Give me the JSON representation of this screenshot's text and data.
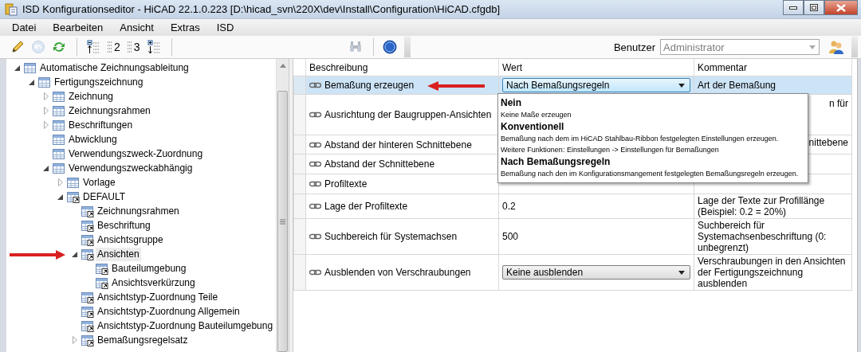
{
  "window": {
    "title": "ISD Konfigurationseditor  - HiCAD 22.1.0.223 [D:\\hicad_svn\\220X\\dev\\Install\\Configuration\\HiCAD.cfgdb]"
  },
  "menu": [
    "Datei",
    "Bearbeiten",
    "Ansicht",
    "Extras",
    "ISD"
  ],
  "toolbar": {
    "buttons": [
      {
        "kind": "edit",
        "disabled": false
      },
      {
        "kind": "undo",
        "disabled": true
      },
      {
        "kind": "refresh",
        "disabled": false
      },
      {
        "kind": "separator"
      },
      {
        "kind": "collapse",
        "disabled": false
      },
      {
        "kind": "level",
        "label": "2",
        "disabled": false
      },
      {
        "kind": "level",
        "label": "3",
        "disabled": false
      },
      {
        "kind": "expand",
        "disabled": false
      },
      {
        "kind": "separator"
      },
      {
        "kind": "spacer"
      },
      {
        "kind": "find",
        "disabled": true
      },
      {
        "kind": "separator"
      },
      {
        "kind": "help",
        "disabled": false
      }
    ],
    "user_label": "Benutzer",
    "user_value": "Administrator"
  },
  "tree": [
    {
      "label": "Automatische Zeichnungsableitung",
      "kind": "table",
      "expanded": true,
      "selected": false,
      "marked": false,
      "children": [
        {
          "label": "Fertigungszeichnung",
          "kind": "table",
          "expanded": true,
          "selected": false,
          "marked": false,
          "children": [
            {
              "label": "Zeichnung",
              "kind": "table",
              "expanded": false,
              "selected": false,
              "marked": false
            },
            {
              "label": "Zeichnungsrahmen",
              "kind": "table",
              "expanded": false,
              "selected": false,
              "marked": false
            },
            {
              "label": "Beschriftungen",
              "kind": "table",
              "expanded": false,
              "selected": false,
              "marked": false
            },
            {
              "label": "Abwicklung",
              "kind": "table",
              "selected": false,
              "marked": false
            },
            {
              "label": "Verwendungszweck-Zuordnung",
              "kind": "table",
              "selected": false,
              "marked": false
            },
            {
              "label": "Verwendungszweckabhängig",
              "kind": "table",
              "expanded": true,
              "selected": false,
              "marked": false,
              "children": [
                {
                  "label": "Vorlage",
                  "kind": "table",
                  "expanded": false,
                  "selected": false,
                  "marked": false
                },
                {
                  "label": "DEFAULT",
                  "kind": "link",
                  "expanded": true,
                  "selected": false,
                  "marked": false,
                  "children": [
                    {
                      "label": "Zeichnungsrahmen",
                      "kind": "link",
                      "selected": false,
                      "marked": false
                    },
                    {
                      "label": "Beschriftung",
                      "kind": "link",
                      "selected": false,
                      "marked": false
                    },
                    {
                      "label": "Ansichtsgruppe",
                      "kind": "link",
                      "selected": false,
                      "marked": false
                    },
                    {
                      "label": "Ansichten",
                      "kind": "link",
                      "expanded": true,
                      "selected": true,
                      "marked": true,
                      "children": [
                        {
                          "label": "Bauteilumgebung",
                          "kind": "link",
                          "selected": false,
                          "marked": false
                        },
                        {
                          "label": "Ansichtsverkürzung",
                          "kind": "link",
                          "selected": false,
                          "marked": false
                        }
                      ]
                    },
                    {
                      "label": "Ansichtstyp-Zuordnung Teile",
                      "kind": "link",
                      "selected": false,
                      "marked": false
                    },
                    {
                      "label": "Ansichtstyp-Zuordnung Allgemein",
                      "kind": "link",
                      "selected": false,
                      "marked": false
                    },
                    {
                      "label": "Ansichtstyp-Zuordnung Bauteilumgebung",
                      "kind": "link",
                      "selected": false,
                      "marked": false
                    },
                    {
                      "label": "Bemaßungsregelsatz",
                      "kind": "link",
                      "expanded": false,
                      "selected": false,
                      "marked": false
                    }
                  ]
                }
              ]
            }
          ]
        }
      ]
    }
  ],
  "grid": {
    "columns": [
      "Beschreibung",
      "Wert",
      "Kommentar"
    ],
    "rows": [
      {
        "description": "Bemaßung erzeugen",
        "kind": "dropdown",
        "value": "Nach Bemaßungsregeln",
        "comment": "Art der Bemaßung",
        "comment_covered": false,
        "selected": true,
        "marked": true,
        "open": true
      },
      {
        "description": "Ausrichtung der Baugruppen-Ansichten",
        "kind": "covered",
        "comment": "n für",
        "comment_covered": true,
        "selected": false,
        "marked": false
      },
      {
        "description": "Abstand der hinteren Schnittebene",
        "kind": "covered",
        "comment": "nittebene",
        "comment_covered": true,
        "selected": false,
        "marked": false
      },
      {
        "description": "Abstand der Schnittebene",
        "kind": "covered",
        "selected": false,
        "marked": false,
        "comment_covered": true
      },
      {
        "description": "Profiltexte",
        "kind": "covered",
        "selected": false,
        "marked": false,
        "comment_covered": true
      },
      {
        "description": "Lage der Profiltexte",
        "kind": "text",
        "value": "0.2",
        "comment": "Lage der Texte zur Profillänge (Beispiel: 0.2 = 20%)",
        "comment_covered": false,
        "selected": false,
        "marked": false
      },
      {
        "description": "Suchbereich für Systemachsen",
        "kind": "text",
        "value": "500",
        "comment": "Suchbereich für Systemachsenbeschriftung (0: unbegrenzt)",
        "comment_covered": false,
        "selected": false,
        "marked": false
      },
      {
        "description": "Ausblenden von Verschraubungen",
        "kind": "dropdown",
        "value": "Keine ausblenden",
        "comment": "Verschraubungen in den Ansichten der Fertigungszeichnung ausblenden",
        "comment_covered": false,
        "selected": false,
        "marked": false,
        "open": false
      }
    ],
    "dropdown_options": [
      {
        "title": "Nein",
        "lines": [
          "Keine Maße erzeugen"
        ]
      },
      {
        "title": "Konventionell",
        "lines": [
          "Bemaßung nach dem im HiCAD Stahlbau-Ribbon festgelegten Einstellungen erzeugen.",
          "Weitere Funktionen: Einstellungen -> Einstellungen für Bemaßungen"
        ]
      },
      {
        "title": "Nach Bemaßungsregeln",
        "lines": [
          "Bemaßung nach den im Konfigurationsmangement festgelegten Bemaßungsregeln erzeugen."
        ]
      }
    ]
  }
}
